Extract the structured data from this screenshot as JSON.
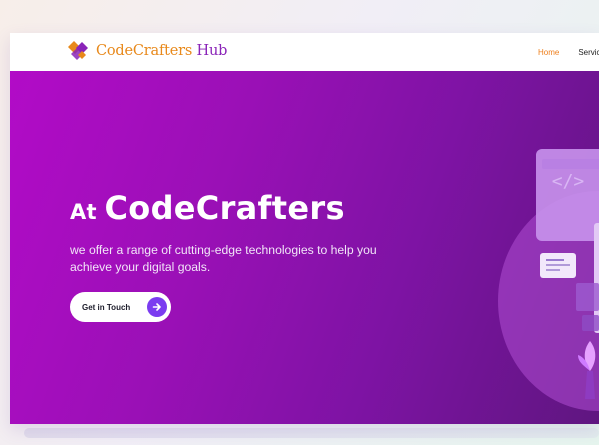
{
  "brand": {
    "name": "CodeCrafters",
    "suffix": " Hub",
    "primary_color": "#e8891b",
    "secondary_color": "#8a24b8"
  },
  "nav": {
    "items": [
      {
        "label": "Home",
        "active": true
      },
      {
        "label": "Services",
        "active": false
      }
    ],
    "active_color": "#ee7f1d"
  },
  "hero": {
    "title_prefix": "At ",
    "title_main": "CodeCrafters",
    "description": "we offer a range of cutting-edge technologies to help you achieve your digital goals.",
    "cta_label": "Get in Touch",
    "cta_icon": "arrow-right-icon",
    "illustration_code_symbol": "</>",
    "background_colors": [
      "#b20bc7",
      "#7e13a4",
      "#5f1680"
    ]
  }
}
